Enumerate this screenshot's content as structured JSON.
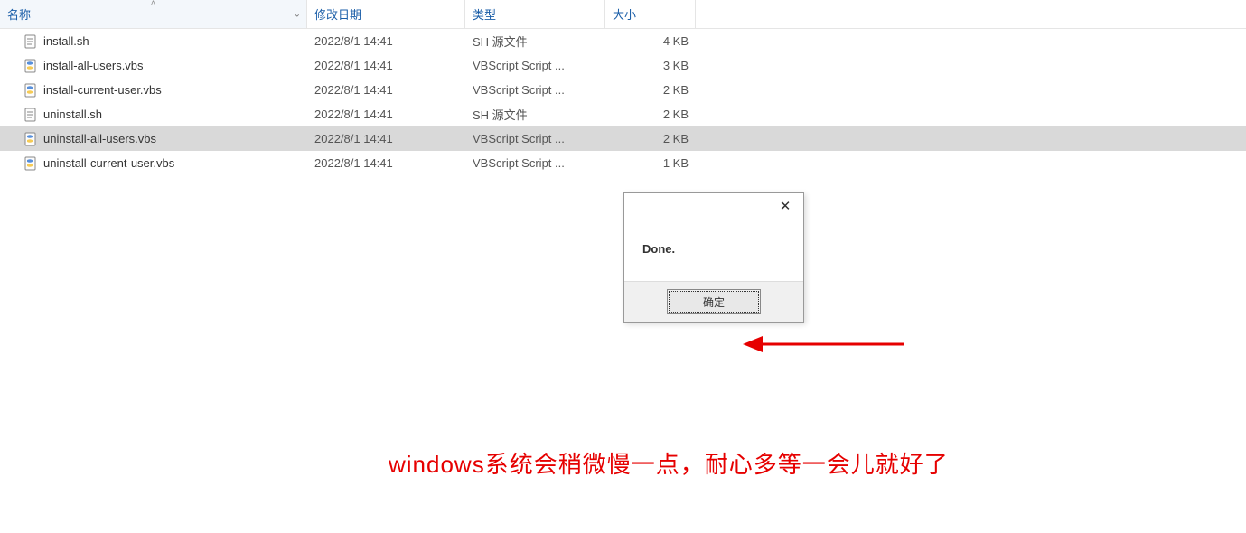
{
  "columns": {
    "name": "名称",
    "date": "修改日期",
    "type": "类型",
    "size": "大小"
  },
  "files": [
    {
      "name": "install.sh",
      "date": "2022/8/1 14:41",
      "type": "SH 源文件",
      "size": "4 KB",
      "icon": "sh",
      "selected": false
    },
    {
      "name": "install-all-users.vbs",
      "date": "2022/8/1 14:41",
      "type": "VBScript Script ...",
      "size": "3 KB",
      "icon": "vbs",
      "selected": false
    },
    {
      "name": "install-current-user.vbs",
      "date": "2022/8/1 14:41",
      "type": "VBScript Script ...",
      "size": "2 KB",
      "icon": "vbs",
      "selected": false
    },
    {
      "name": "uninstall.sh",
      "date": "2022/8/1 14:41",
      "type": "SH 源文件",
      "size": "2 KB",
      "icon": "sh",
      "selected": false
    },
    {
      "name": "uninstall-all-users.vbs",
      "date": "2022/8/1 14:41",
      "type": "VBScript Script ...",
      "size": "2 KB",
      "icon": "vbs",
      "selected": true
    },
    {
      "name": "uninstall-current-user.vbs",
      "date": "2022/8/1 14:41",
      "type": "VBScript Script ...",
      "size": "1 KB",
      "icon": "vbs",
      "selected": false
    }
  ],
  "dialog": {
    "message": "Done.",
    "ok_label": "确定"
  },
  "caption": "windows系统会稍微慢一点，耐心多等一会儿就好了"
}
